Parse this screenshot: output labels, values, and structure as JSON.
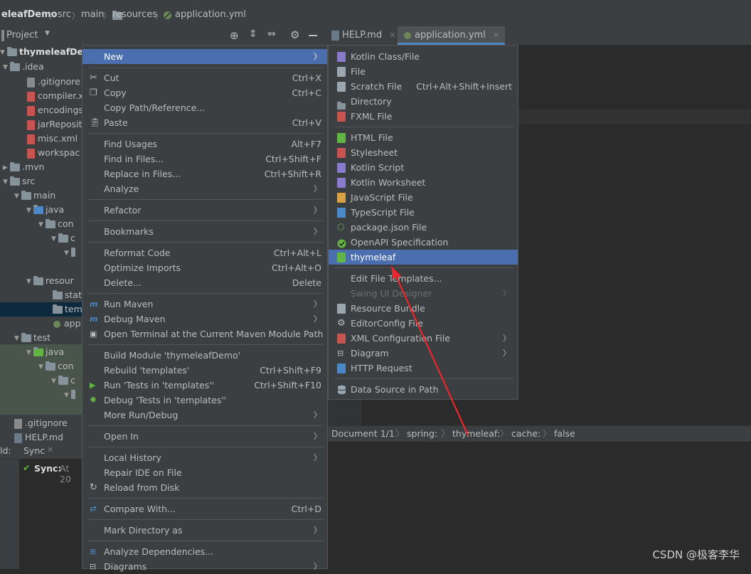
{
  "breadcrumb": {
    "items": [
      "eleafDemo",
      "src",
      "main",
      "resources",
      "application.yml"
    ]
  },
  "project_toolbar": {
    "title": "Project"
  },
  "editor_tabs": [
    {
      "label": "HELP.md"
    },
    {
      "label": "application.yml"
    }
  ],
  "tree": {
    "rows": [
      {
        "label": "thymeleafDemo",
        "bold": true
      },
      {
        "label": ".idea"
      },
      {
        "label": ".gitignore"
      },
      {
        "label": "compiler.x"
      },
      {
        "label": "encodings"
      },
      {
        "label": "jarReposit"
      },
      {
        "label": "misc.xml"
      },
      {
        "label": "workspac"
      },
      {
        "label": ".mvn"
      },
      {
        "label": "src"
      },
      {
        "label": "main"
      },
      {
        "label": "java"
      },
      {
        "label": "con"
      },
      {
        "label": "c"
      },
      {
        "label": ""
      },
      {
        "label": "resour"
      },
      {
        "label": "stat"
      },
      {
        "label": "tem"
      },
      {
        "label": "app"
      },
      {
        "label": "test"
      },
      {
        "label": "java"
      },
      {
        "label": "con"
      },
      {
        "label": "c"
      },
      {
        "label": ""
      },
      {
        "label": ".gitignore"
      },
      {
        "label": "HELP.md"
      }
    ]
  },
  "bottom_panel": {
    "tab_build": "ld:",
    "tab_sync": "Sync",
    "sync_label": "Sync:",
    "sync_time": "At 20"
  },
  "context_menu": {
    "items": [
      {
        "label": "New",
        "submenu": true,
        "selected": true
      },
      {
        "sep": true
      },
      {
        "label": "Cut",
        "shortcut": "Ctrl+X",
        "icon": "scissors-icon"
      },
      {
        "label": "Copy",
        "shortcut": "Ctrl+C",
        "icon": "copy-icon"
      },
      {
        "label": "Copy Path/Reference..."
      },
      {
        "label": "Paste",
        "shortcut": "Ctrl+V",
        "icon": "paste-icon"
      },
      {
        "sep": true
      },
      {
        "label": "Find Usages",
        "shortcut": "Alt+F7"
      },
      {
        "label": "Find in Files...",
        "shortcut": "Ctrl+Shift+F"
      },
      {
        "label": "Replace in Files...",
        "shortcut": "Ctrl+Shift+R"
      },
      {
        "label": "Analyze",
        "submenu": true
      },
      {
        "sep": true
      },
      {
        "label": "Refactor",
        "submenu": true
      },
      {
        "sep": true
      },
      {
        "label": "Bookmarks",
        "submenu": true
      },
      {
        "sep": true
      },
      {
        "label": "Reformat Code",
        "shortcut": "Ctrl+Alt+L"
      },
      {
        "label": "Optimize Imports",
        "shortcut": "Ctrl+Alt+O"
      },
      {
        "label": "Delete...",
        "shortcut": "Delete"
      },
      {
        "sep": true
      },
      {
        "label": "Run Maven",
        "submenu": true,
        "icon": "maven-icon"
      },
      {
        "label": "Debug Maven",
        "submenu": true,
        "icon": "maven-debug-icon"
      },
      {
        "label": "Open Terminal at the Current Maven Module Path",
        "icon": "terminal-icon"
      },
      {
        "sep": true
      },
      {
        "label": "Build Module 'thymeleafDemo'"
      },
      {
        "label": "Rebuild 'templates'",
        "shortcut": "Ctrl+Shift+F9"
      },
      {
        "label": "Run 'Tests in 'templates''",
        "shortcut": "Ctrl+Shift+F10",
        "icon": "run-icon"
      },
      {
        "label": "Debug 'Tests in 'templates''",
        "icon": "debug-icon"
      },
      {
        "label": "More Run/Debug",
        "submenu": true
      },
      {
        "sep": true
      },
      {
        "label": "Open In",
        "submenu": true
      },
      {
        "sep": true
      },
      {
        "label": "Local History",
        "submenu": true
      },
      {
        "label": "Repair IDE on File"
      },
      {
        "label": "Reload from Disk",
        "icon": "reload-icon"
      },
      {
        "sep": true
      },
      {
        "label": "Compare With...",
        "shortcut": "Ctrl+D",
        "icon": "compare-icon"
      },
      {
        "sep": true
      },
      {
        "label": "Mark Directory as",
        "submenu": true
      },
      {
        "sep": true
      },
      {
        "label": "Analyze Dependencies...",
        "icon": "dependencies-icon"
      },
      {
        "label": "Diagrams",
        "submenu": true,
        "icon": "diagram-icon"
      }
    ]
  },
  "new_submenu": {
    "items": [
      {
        "label": "Kotlin Class/File",
        "icon": "kotlin-file-icon"
      },
      {
        "label": "File",
        "icon": "file-icon"
      },
      {
        "label": "Scratch File",
        "shortcut": "Ctrl+Alt+Shift+Insert",
        "icon": "scratch-file-icon"
      },
      {
        "label": "Directory",
        "icon": "folder-icon"
      },
      {
        "label": "FXML File",
        "icon": "fxml-file-icon"
      },
      {
        "sep": true
      },
      {
        "label": "HTML File",
        "icon": "html-file-icon"
      },
      {
        "label": "Stylesheet",
        "icon": "css-file-icon"
      },
      {
        "label": "Kotlin Script",
        "icon": "kotlin-script-icon"
      },
      {
        "label": "Kotlin Worksheet",
        "icon": "kotlin-worksheet-icon"
      },
      {
        "label": "JavaScript File",
        "icon": "js-file-icon"
      },
      {
        "label": "TypeScript File",
        "icon": "ts-file-icon"
      },
      {
        "label": "package.json File",
        "icon": "nodejs-icon"
      },
      {
        "label": "OpenAPI Specification",
        "icon": "openapi-icon"
      },
      {
        "label": "thymeleaf",
        "icon": "html-file-icon",
        "selected": true
      },
      {
        "sep": true
      },
      {
        "label": "Edit File Templates..."
      },
      {
        "label": "Swing UI Designer",
        "submenu": true,
        "disabled": true
      },
      {
        "label": "Resource Bundle",
        "icon": "resource-bundle-icon"
      },
      {
        "label": "EditorConfig File",
        "icon": "gear-icon"
      },
      {
        "label": "XML Configuration File",
        "submenu": true,
        "icon": "xml-file-icon"
      },
      {
        "label": "Diagram",
        "submenu": true,
        "icon": "diagram-icon"
      },
      {
        "label": "HTTP Request",
        "icon": "api-icon"
      },
      {
        "sep": true
      },
      {
        "label": "Data Source in Path",
        "icon": "database-icon"
      }
    ]
  },
  "editor_breadcrumb": {
    "items": [
      "Document 1/1",
      "spring:",
      "thymeleaf:",
      "cache:",
      "false"
    ]
  },
  "watermark": "CSDN @极客李华",
  "colors": {
    "selection": "#4b6eaf",
    "panel": "#3c3f41",
    "editor_bg": "#2b2b2b",
    "arrow": "#e8262d"
  }
}
